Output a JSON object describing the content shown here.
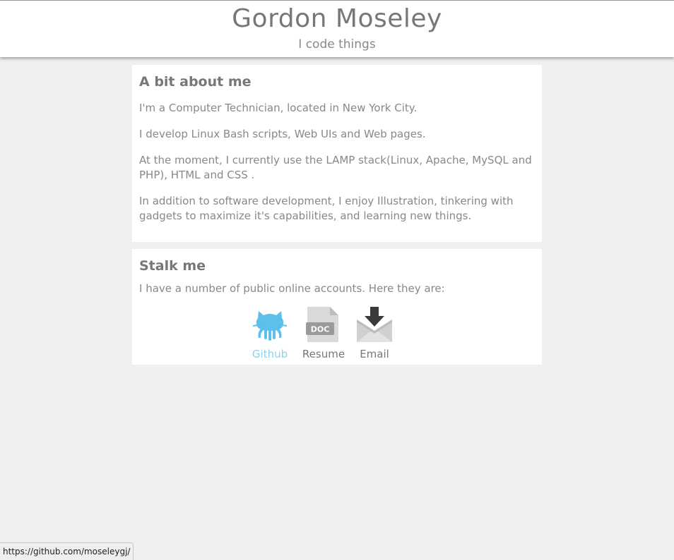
{
  "header": {
    "name": "Gordon Moseley",
    "tagline": "I code things"
  },
  "about": {
    "title": "A bit about me",
    "paragraphs": [
      "I'm a Computer Technician, located in New York City.",
      "I develop Linux Bash scripts, Web UIs and Web pages.",
      "At the moment, I currently use the LAMP stack(Linux, Apache, MySQL and PHP), HTML and CSS .",
      "In addition to software development, I enjoy Illustration, tinkering with gadgets to maximize it's capabilities, and learning new things."
    ]
  },
  "stalk": {
    "title": "Stalk me",
    "intro": "I have a number of public online accounts. Here they are:",
    "links": [
      {
        "label": "Github",
        "icon": "github-octocat-icon",
        "color": "#5bc0eb"
      },
      {
        "label": "Resume",
        "icon": "doc-file-icon",
        "badge": "DOC"
      },
      {
        "label": "Email",
        "icon": "envelope-download-icon"
      }
    ]
  },
  "status": {
    "url": "https://github.com/moseleygj/"
  },
  "colors": {
    "background": "#efefef",
    "card": "#ffffff",
    "text": "#777777",
    "github_accent": "#5bc0eb"
  }
}
